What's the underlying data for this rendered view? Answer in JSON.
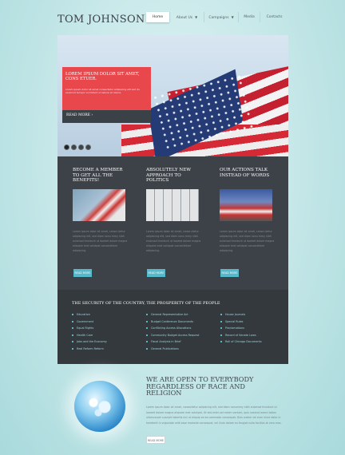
{
  "header": {
    "logo": "TOM JOHNSON",
    "nav": [
      {
        "label": "Home",
        "active": true
      },
      {
        "label": "About Us",
        "caret": true
      },
      {
        "label": "Campaigns",
        "caret": true
      },
      {
        "label": "Media"
      },
      {
        "label": "Contacts"
      }
    ]
  },
  "hero": {
    "title": "LOREM IPSUM DOLOR SIT AMET, CONS ETUER.",
    "text": "Lorem ipsum dolor sit amet consectetur adipiscing elit sed do eiusmod tempor incididunt ut labore et dolore.",
    "more": "READ MORE  ›",
    "slides": 4
  },
  "columns": [
    {
      "title": "BECOME A MEMBER TO GET ALL THE BENEFITS!",
      "image": "statue-of-liberty-image",
      "text": "Lorem ipsum dolor sit amet, conse ctetur adipiscing elit, sed diam nonu mmy nibh euismod tincidunt ut laoreet dolore magna aliquam erat volutpat consectetuer adipiscing.",
      "button": "READ MORE"
    },
    {
      "title": "ABSOLUTELY NEW APPROACH TO POLITICS",
      "image": "keyboard-flag-key-image",
      "text": "Lorem ipsum dolor sit amet, conse ctetur adipiscing elit, sed diam nonu mmy nibh euismod tincidunt ut laoreet dolore magna aliquam erat volutpat consectetuer adipiscing.",
      "button": "READ MORE"
    },
    {
      "title": "OUR ACTIONS TALK INSTEAD OF WORDS",
      "image": "flags-rally-image",
      "text": "Lorem ipsum dolor sit amet, conse ctetur adipiscing elit, sed diam nonu mmy nibh euismod tincidunt ut laoreet dolore magna aliquam erat volutpat consectetuer adipiscing.",
      "button": "READ MORE"
    }
  ],
  "band": {
    "title": "THE SECURITY OF THE COUNTRY, THE PROSPERITY OF THE PEOPLE",
    "links": [
      [
        "Education",
        "Government",
        "Equal Rights",
        "Health Care",
        "Jobs and the Economy",
        "Real Reform Reform"
      ],
      [
        "General Representative Act",
        "Budget Conference Documents",
        "Conflicting Access Allocations",
        "Community Budget Access Request",
        "Fiscal Analysis in Brief",
        "General Publications"
      ],
      [
        "House Journals",
        "Special Rules",
        "Proclamations",
        "Record of Senate Laws",
        "Roll of Chicago Documents"
      ]
    ]
  },
  "open": {
    "title": "WE ARE OPEN TO EVERYBODY REGARDLESS OF RACE AND RELIGION",
    "text": "Lorem ipsum dolor sit amet, consectetur adipiscing elit, sed diam nonummy nibh euismod tincidunt ut laoreet dolore magna aliquam erat volutpat. Ut wisi enim ad minim veniam, quis nostrud exerci tation ullamcorper suscipit lobortis nisl ut aliquip ex ea commodo consequat. Duis autem vel eum iriure dolor in hendrerit in vulputate velit esse molestie consequat, vel illum dolore eu feugiat nulla facilisis at vero eros.",
    "button": "READ MORE"
  }
}
